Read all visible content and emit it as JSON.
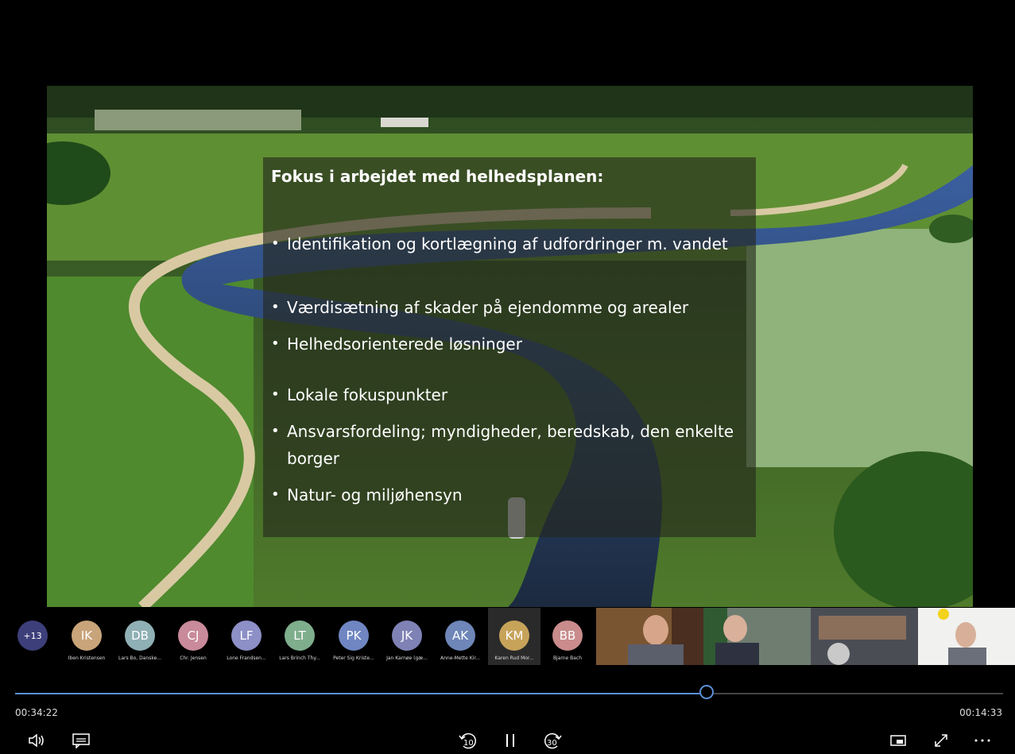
{
  "slide": {
    "heading": "Fokus i arbejdet med helhedsplanen:",
    "bullets": [
      "Identifikation og kortlægning af udfordringer m. vandet",
      "Værdisætning af skader på ejendomme og arealer",
      "Helhedsorienterede løsninger",
      "Lokale fokuspunkter",
      "Ansvarsfordeling; myndigheder, beredskab, den enkelte borger",
      "Natur- og miljøhensyn"
    ]
  },
  "participants": {
    "overflow_count": "+13",
    "people": [
      {
        "initials": "IK",
        "name": "Iben Kristensen",
        "color": "#c9a47a"
      },
      {
        "initials": "DB",
        "name": "Lars Bo, Danske...",
        "color": "#8fb0b5"
      },
      {
        "initials": "CJ",
        "name": "Chr. Jensen",
        "color": "#c98a9b"
      },
      {
        "initials": "LF",
        "name": "Lone Frandsen...",
        "color": "#8d8fc7"
      },
      {
        "initials": "LT",
        "name": "Lars Brinch Thy...",
        "color": "#7fae8d"
      },
      {
        "initials": "PK",
        "name": "Peter Sig Kriste...",
        "color": "#6f86c2"
      },
      {
        "initials": "JK",
        "name": "Jan Karnøe (gæ...",
        "color": "#7f82b5"
      },
      {
        "initials": "AK",
        "name": "Anne-Mette Kir...",
        "color": "#6e86b8"
      },
      {
        "initials": "KM",
        "name": "Karen Rud Mor...",
        "color": "#c7a35a"
      },
      {
        "initials": "BB",
        "name": "Bjarne Bach",
        "color": "#c98b8b"
      }
    ]
  },
  "player": {
    "elapsed": "00:34:22",
    "remaining": "00:14:33",
    "progress_fraction": 0.7,
    "rewind_label": "10",
    "forward_label": "30"
  },
  "colors": {
    "accent": "#5b8fd6"
  }
}
